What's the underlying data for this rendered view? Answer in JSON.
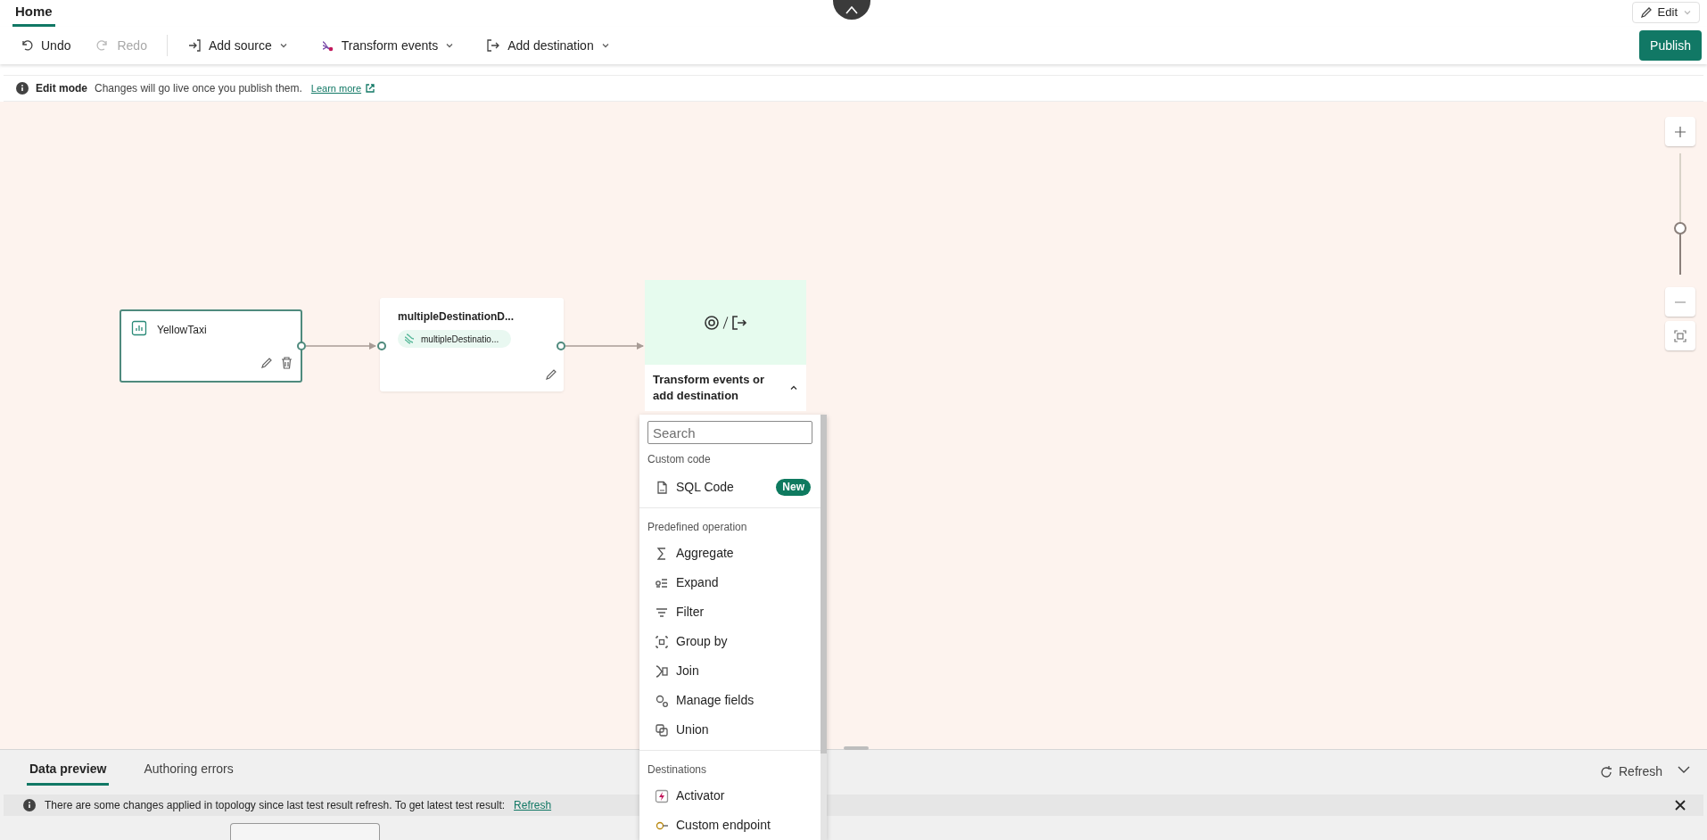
{
  "tabs": [
    {
      "label": "Home",
      "selected": true
    }
  ],
  "edit_button": {
    "label": "Edit"
  },
  "toolbar": [
    {
      "kind": "undo",
      "label": "Undo",
      "disabled": false,
      "dropdown": false
    },
    {
      "kind": "redo",
      "label": "Redo",
      "disabled": true,
      "dropdown": false
    },
    {
      "kind": "source",
      "label": "Add source",
      "disabled": false,
      "dropdown": true
    },
    {
      "kind": "transform",
      "label": "Transform events",
      "disabled": false,
      "dropdown": true
    },
    {
      "kind": "destination",
      "label": "Add destination",
      "disabled": false,
      "dropdown": true
    }
  ],
  "publish_button": {
    "label": "Publish"
  },
  "banner": {
    "title": "Edit mode",
    "message": "Changes will go live once you publish them.",
    "link": "Learn more"
  },
  "canvas": {
    "source_node": {
      "title": "YellowTaxi"
    },
    "stream_node": {
      "title": "multipleDestinationD...",
      "chip": "multipleDestinatio..."
    },
    "next_step": {
      "label": "Transform events or add destination",
      "expanded": true
    },
    "zoom": {
      "level": 0.38
    }
  },
  "menu": {
    "search_placeholder": "Search",
    "sections": [
      {
        "heading": "Custom code",
        "items": [
          {
            "kind": "sql",
            "label": "SQL Code",
            "badge": "New"
          }
        ]
      },
      {
        "heading": "Predefined operation",
        "items": [
          {
            "kind": "aggregate",
            "label": "Aggregate"
          },
          {
            "kind": "expand",
            "label": "Expand"
          },
          {
            "kind": "filter",
            "label": "Filter"
          },
          {
            "kind": "groupby",
            "label": "Group by"
          },
          {
            "kind": "join",
            "label": "Join"
          },
          {
            "kind": "manage",
            "label": "Manage fields"
          },
          {
            "kind": "union",
            "label": "Union"
          }
        ]
      },
      {
        "heading": "Destinations",
        "items": [
          {
            "kind": "activator",
            "label": "Activator"
          },
          {
            "kind": "endpoint",
            "label": "Custom endpoint"
          }
        ]
      }
    ]
  },
  "bottom_panel": {
    "tabs": [
      {
        "label": "Data preview",
        "selected": true
      },
      {
        "label": "Authoring errors",
        "selected": false
      }
    ],
    "refresh": "Refresh",
    "notice": {
      "message": "There are some changes applied in topology since last test result refresh. To get latest test result:",
      "link": "Refresh"
    }
  }
}
